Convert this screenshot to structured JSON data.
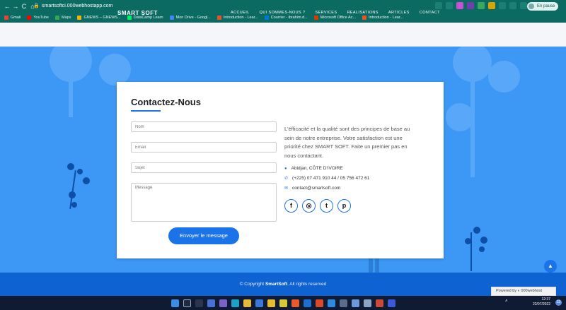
{
  "browser": {
    "back": "←",
    "forward": "→",
    "reload": "C",
    "home": "⌂",
    "url": "smartsoftci.000webhostapp.com",
    "profile_label": "En pause",
    "bookmarks": [
      {
        "label": "Gmail",
        "color": "#ea4335"
      },
      {
        "label": "YouTube",
        "color": "#ff0000"
      },
      {
        "label": "Maps",
        "color": "#34a853"
      },
      {
        "label": "GNEWS – GNEWS...",
        "color": "#f4b400"
      },
      {
        "label": "DataCamp Learn",
        "color": "#03ef62"
      },
      {
        "label": "Mon Drive - Googl...",
        "color": "#4285f4"
      },
      {
        "label": "Introduction - Lear...",
        "color": "#f25022"
      },
      {
        "label": "Courrier - ibrahim.d...",
        "color": "#0078d4"
      },
      {
        "label": "Microsoft Office Ac...",
        "color": "#d83b01"
      },
      {
        "label": "Introduction - Lear...",
        "color": "#f25022"
      }
    ]
  },
  "site": {
    "logo": "SMART SOFT",
    "menu": [
      "ACCUEIL",
      "QUI SOMMES-NOUS ?",
      "SERVICES",
      "REALISATIONS",
      "ARTICLES",
      "CONTACT"
    ]
  },
  "contact": {
    "title": "Contactez-Nous",
    "name_placeholder": "Nom",
    "email_placeholder": "Email",
    "subject_placeholder": "Sujet",
    "message_placeholder": "Message",
    "send_label": "Envoyer le message",
    "description": "L'éfficacité et la qualité sont des principes de base au sein de notre entreprise. Votre satisfaction est une priorité chez SMART SOFT. Faite un premier pas en nous contactant.",
    "location": "Abidjan, CÔTE D'IVOIRE",
    "phone": "(+225) 07 471 910 44 / 05 756 472 61",
    "email": "contact@smartsoft.com",
    "socials": [
      "f",
      "◎",
      "t",
      "p"
    ]
  },
  "footer": {
    "prefix": "© Copyright ",
    "brand": "SmartSoft",
    "suffix": ". All rights reserved",
    "powered": "Powered by ◐ 000webhost"
  },
  "taskbar": {
    "time": "12:37",
    "date": "22/07/2022",
    "notifications": "13"
  }
}
